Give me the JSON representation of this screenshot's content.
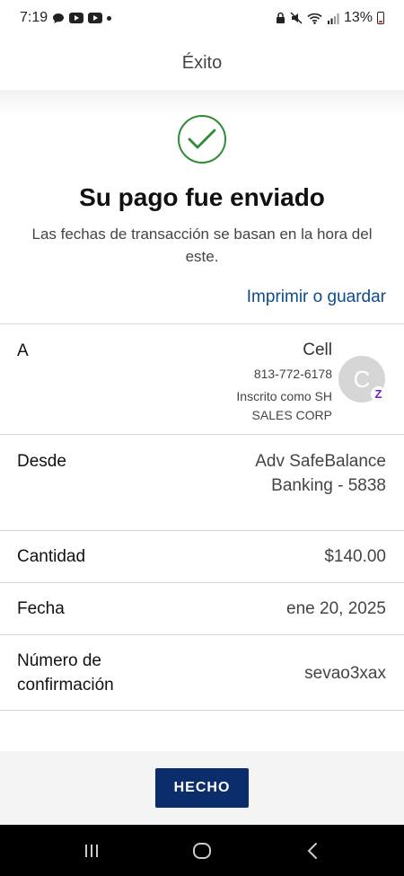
{
  "status_bar": {
    "time": "7:19",
    "battery": "13%",
    "icons": [
      "chat-bubble-icon",
      "youtube-icon",
      "youtube-icon",
      "notification-dot-icon",
      "lock-icon",
      "mute-icon",
      "wifi-icon",
      "signal-icon",
      "battery-icon"
    ]
  },
  "header": {
    "title": "Éxito"
  },
  "success": {
    "title": "Su pago fue enviado",
    "subtitle": "Las fechas de transacción se basan en la hora del este.",
    "print_link": "Imprimir o guardar"
  },
  "details": {
    "to_label": "A",
    "recipient_name": "Cell",
    "recipient_phone": "813-772-6178",
    "recipient_enrolled_line1": "Inscrito como SH",
    "recipient_enrolled_line2": "SALES CORP",
    "avatar_letter": "C",
    "zelle_badge": "Z",
    "from_label": "Desde",
    "from_line1": "Adv SafeBalance",
    "from_line2": "Banking - 5838",
    "amount_label": "Cantidad",
    "amount_value": "$140.00",
    "date_label": "Fecha",
    "date_value": "ene 20, 2025",
    "confirmation_label_line1": "Número de",
    "confirmation_label_line2": "confirmación",
    "confirmation_value": "sevao3xax"
  },
  "actions": {
    "done_label": "HECHO"
  },
  "colors": {
    "accent": "#0d4a8c",
    "button": "#0c2d6b",
    "success": "#2e8b36",
    "zelle": "#6c1cd3"
  }
}
